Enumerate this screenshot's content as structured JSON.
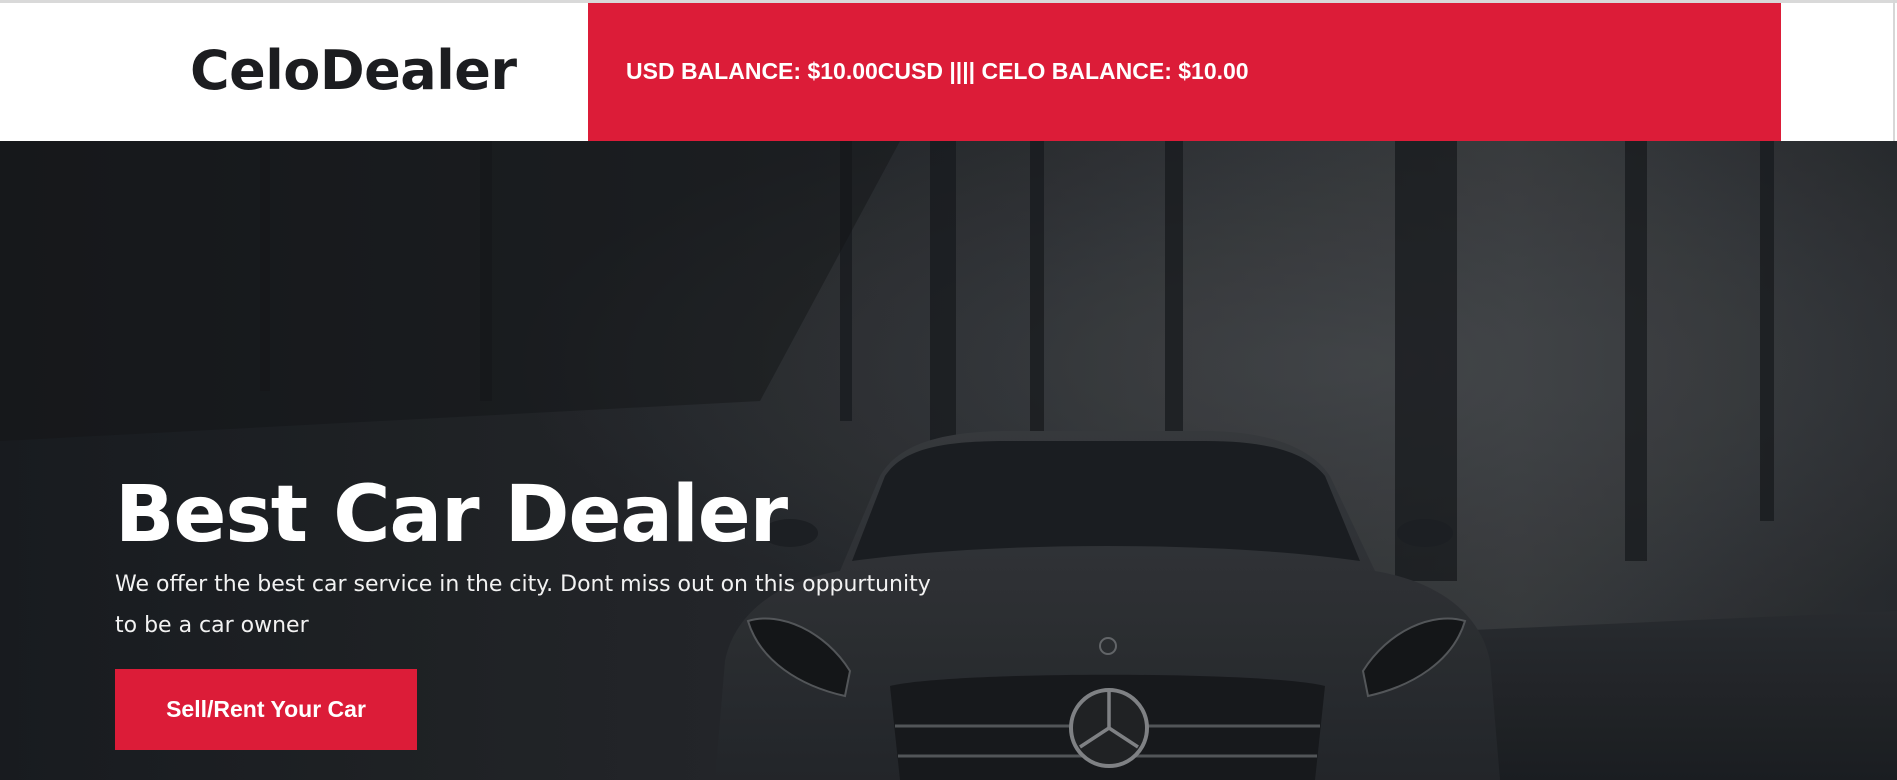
{
  "header": {
    "brand": "CeloDealer",
    "balance_text": "USD BALANCE: $10.00CUSD |||| CELO BALANCE: $10.00"
  },
  "hero": {
    "title": "Best Car Dealer",
    "subtitle": "We offer the best car service in the city. Dont miss out on this oppurtunity to be a car owner",
    "cta_label": "Sell/Rent Your Car",
    "background_image": "car-in-dark-forest-photo"
  },
  "colors": {
    "accent": "#dc1c38",
    "brand_text": "#1c1d20",
    "hero_overlay": "#22252a"
  }
}
